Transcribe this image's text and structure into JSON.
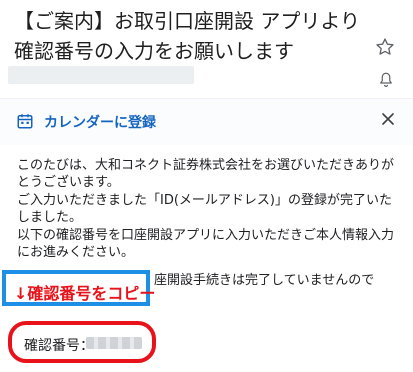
{
  "email": {
    "subject": "【ご案内】お取引口座開設 アプリより確認番号の入力をお願いします"
  },
  "calendar_bar": {
    "label": "カレンダーに登録"
  },
  "body": {
    "lines": [
      "このたびは、大和コネクト証券株式会社をお選びいただきありがとうございます。",
      "ご入力いただきました「ID(メールアドレス)」の登録が完了いたしました。",
      "以下の確認番号を口座開設アプリに入力いただきご本人情報入力にお進みください。"
    ],
    "line_partial": "座開設手続きは完了していませんので"
  },
  "annotations": {
    "copy_callout": "↓確認番号をコピー"
  },
  "code": {
    "label": "確認番号："
  },
  "colors": {
    "callout_blue": "#1e8fe6",
    "callout_red": "#e8131a",
    "link_blue": "#1565c0"
  }
}
